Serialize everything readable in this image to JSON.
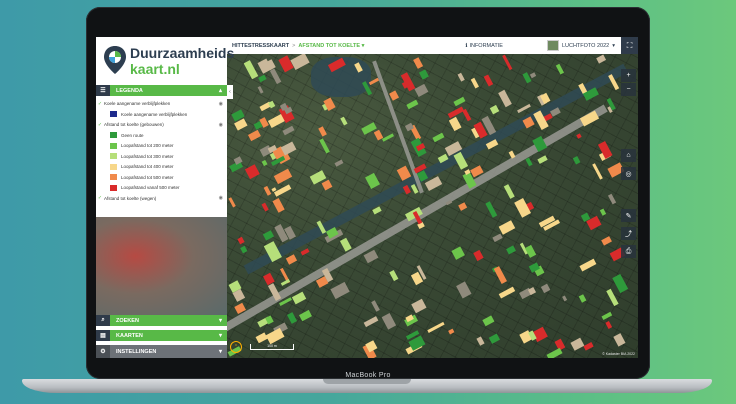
{
  "device": {
    "label": "MacBook Pro"
  },
  "colors": {
    "brand_green": "#58b947",
    "navy": "#2d3e50"
  },
  "sidebar": {
    "logo": {
      "line1": "Duurzaamheids",
      "line2": "kaart.nl"
    },
    "legend_header": "LEGENDA",
    "legend": [
      {
        "label": "Koele aangename verblijfplekken",
        "type": "group"
      },
      {
        "label": "Koele aangename verblijfplekken",
        "type": "item",
        "color": "#1d2a8c"
      },
      {
        "label": "Afstand tot koelte (gebouwen)",
        "type": "group"
      },
      {
        "label": "Geen route",
        "type": "item",
        "color": "#2e9a3b"
      },
      {
        "label": "Loopafstand tot 200 meter",
        "type": "item",
        "color": "#6cc54b"
      },
      {
        "label": "Loopafstand tot 300 meter",
        "type": "item",
        "color": "#b6df7a"
      },
      {
        "label": "Loopafstand tot 400 meter",
        "type": "item",
        "color": "#f7d78a"
      },
      {
        "label": "Loopafstand tot 500 meter",
        "type": "item",
        "color": "#f08a4b"
      },
      {
        "label": "Loopafstand vanaf 500 meter",
        "type": "item",
        "color": "#d92b2b"
      },
      {
        "label": "Afstand tot koelte (wegen)",
        "type": "group"
      }
    ],
    "menu": {
      "zoeken": "ZOEKEN",
      "kaarten": "KAARTEN",
      "instellingen": "INSTELLINGEN"
    }
  },
  "topbar": {
    "title": "HITTESTRESSKAART",
    "separator": ">",
    "layer": "AFSTAND TOT KOELTE",
    "info": "INFORMATIE",
    "basemap": "LUCHTFOTO 2022"
  },
  "map": {
    "attribution": "© Kadaster BIA 2022",
    "scale": "100 m"
  }
}
